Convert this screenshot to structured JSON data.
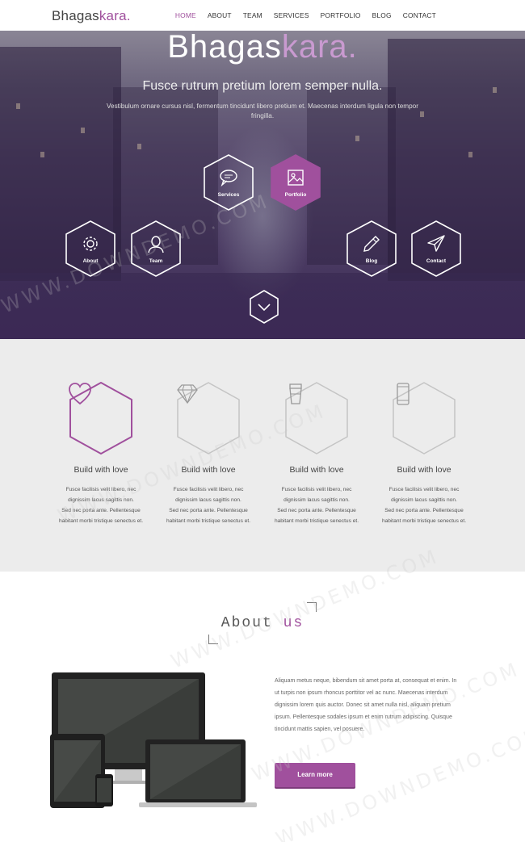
{
  "nav": {
    "logo_base": "Bhagas",
    "logo_accent": "kara.",
    "items": [
      "HOME",
      "ABOUT",
      "TEAM",
      "SERVICES",
      "PORTFOLIO",
      "BLOG",
      "CONTACT"
    ],
    "active": "HOME"
  },
  "hero": {
    "title_base": "Bhagas",
    "title_accent": "kara.",
    "subtitle": "Fusce rutrum pretium lorem semper nulla.",
    "description": "Vestibulum ornare cursus nisl, fermentum tincidunt libero pretium et. Maecenas interdum ligula non tempor fringilla.",
    "hexes": [
      {
        "label": "Services",
        "icon": "speech-bubble-icon",
        "active": false
      },
      {
        "label": "Portfolio",
        "icon": "picture-icon",
        "active": true
      },
      {
        "label": "About",
        "icon": "gear-icon",
        "active": false
      },
      {
        "label": "Team",
        "icon": "person-icon",
        "active": false
      },
      {
        "label": "Blog",
        "icon": "pencil-icon",
        "active": false
      },
      {
        "label": "Contact",
        "icon": "paper-plane-icon",
        "active": false
      }
    ]
  },
  "features": [
    {
      "title": "Build with love",
      "icon": "heart-icon",
      "highlight": true,
      "line1": "Fusce facilisis velit libero, nec",
      "line2": "dignissim lacus sagittis non.",
      "line3": "Sed nec porta ante. Pellentesque",
      "line4": "habitant morbi tristique senectus et."
    },
    {
      "title": "Build with love",
      "icon": "diamond-icon",
      "highlight": false,
      "line1": "Fusce facilisis velit libero, nec",
      "line2": "dignissim lacus sagittis non.",
      "line3": "Sed nec porta ante. Pellentesque",
      "line4": "habitant morbi tristique senectus et."
    },
    {
      "title": "Build with love",
      "icon": "cup-icon",
      "highlight": false,
      "line1": "Fusce facilisis velit libero, nec",
      "line2": "dignissim lacus sagittis non.",
      "line3": "Sed nec porta ante. Pellentesque",
      "line4": "habitant morbi tristique senectus et."
    },
    {
      "title": "Build with love",
      "icon": "phone-icon",
      "highlight": false,
      "line1": "Fusce facilisis velit libero, nec",
      "line2": "dignissim lacus sagittis non.",
      "line3": "Sed nec porta ante. Pellentesque",
      "line4": "habitant morbi tristique senectus et."
    }
  ],
  "about": {
    "title_base": "About",
    "title_accent": "us",
    "text": "Aliquam metus neque, bibendum sit amet porta at, consequat et enim. In ut turpis non ipsum rhoncus porttitor vel ac nunc. Maecenas interdum dignissim lorem quis auctor. Donec sit amet nulla nisl, aliquam pretium ipsum. Pellentesque sodales ipsum et enim rutrum adipiscing. Quisque tincidunt mattis sapien, vel posuere.",
    "button": "Learn more"
  },
  "watermark": "WWW.DOWNDEMO.COM",
  "colors": {
    "accent": "#a0509d",
    "features_bg": "#ececec"
  }
}
